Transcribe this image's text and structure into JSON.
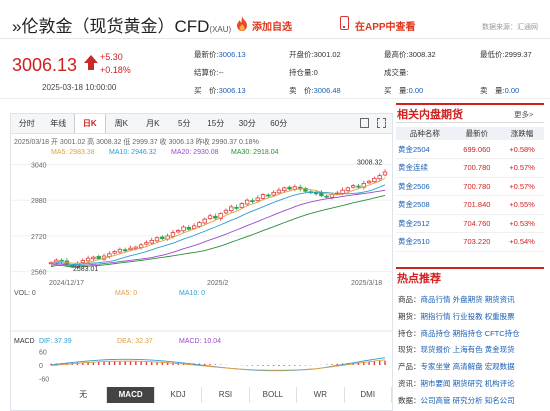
{
  "header": {
    "title": "»伦敦金（现货黄金）CFD",
    "code": "(XAU)",
    "add_favorite": "添加自选",
    "view_in_app": "在APP中查看",
    "source": "数据来源：汇通网"
  },
  "quote": {
    "price": "3006.13",
    "change": "+5.30",
    "change_pct": "+0.18%",
    "time": "2025-03-18 10:00:00"
  },
  "stats": [
    {
      "label": "最新价:",
      "value": "3006.13",
      "cls": "b"
    },
    {
      "label": "开盘价:",
      "value": "3001.02",
      "cls": "v"
    },
    {
      "label": "最高价:",
      "value": "3008.32",
      "cls": "v"
    },
    {
      "label": "最低价:",
      "value": "2999.37",
      "cls": "v"
    },
    {
      "label": "结算价:",
      "value": "--",
      "cls": "v"
    },
    {
      "label": "持仓量:",
      "value": "0",
      "cls": "v"
    },
    {
      "label": "成交量:",
      "value": "",
      "cls": "v"
    },
    {
      "label": "",
      "value": "",
      "cls": "v"
    },
    {
      "label": "买　价:",
      "value": "3006.13",
      "cls": "b"
    },
    {
      "label": "卖　价:",
      "value": "3006.48",
      "cls": "b"
    },
    {
      "label": "买　量:",
      "value": "0.00",
      "cls": "b"
    },
    {
      "label": "卖　量:",
      "value": "0.00",
      "cls": "b"
    }
  ],
  "chart": {
    "tabs": [
      "分时",
      "年线",
      "日K",
      "周K",
      "月K",
      "5分",
      "15分",
      "30分",
      "60分"
    ],
    "active_tab": "日K",
    "ohlc_line": {
      "date": "2025/03/18",
      "open": "开 3001.02",
      "high": "高 3008.32",
      "low": "低 2999.37",
      "close": "收 3006.13",
      "prev_close": "昨收 2990.37",
      "pct": "0.18%"
    },
    "ma": {
      "ma5": "MA5: 2983.38",
      "ma10": "MA10: 2946.32",
      "ma20": "MA20: 2930.08",
      "ma30": "MA30: 2918.04"
    },
    "y_ticks": [
      "3040",
      "2880",
      "2720",
      "2560"
    ],
    "max_label": "3008.32",
    "min_label": "2583.01",
    "x_labels": [
      "2024/12/17",
      "2025/2",
      "2025/3/18"
    ],
    "vol": {
      "label": "VOL: 0",
      "ma5": "MA5: 0",
      "ma10": "MA10: 0"
    },
    "macd": {
      "label": "MACD",
      "dif": "DIF: 37.39",
      "dea": "DEA: 32.37",
      "macd": "MACD: 10.04",
      "ticks": [
        "60",
        "0",
        "-60"
      ]
    },
    "bottom_tabs": [
      "无",
      "MACD",
      "KDJ",
      "RSI",
      "BOLL",
      "WR",
      "DMI"
    ],
    "active_bottom": "MACD"
  },
  "colors": {
    "up": "#e03c3c",
    "down": "#2aa44a",
    "ma5": "#e0a040",
    "ma10": "#2aa0d0",
    "ma20": "#9c4ad0",
    "ma30": "#2c8e3a"
  },
  "futures": {
    "title": "相关内盘期货",
    "more": "更多>",
    "headers": [
      "品种名称",
      "最新价",
      "涨跌幅"
    ],
    "rows": [
      {
        "name": "黄金2504",
        "price": "699.060",
        "pct": "+0.58%"
      },
      {
        "name": "黄金连续",
        "price": "700.780",
        "pct": "+0.57%"
      },
      {
        "name": "黄金2506",
        "price": "700.780",
        "pct": "+0.57%"
      },
      {
        "name": "黄金2508",
        "price": "701.840",
        "pct": "+0.55%"
      },
      {
        "name": "黄金2512",
        "price": "704.760",
        "pct": "+0.53%"
      },
      {
        "name": "黄金2510",
        "price": "703.220",
        "pct": "+0.54%"
      }
    ]
  },
  "hot": {
    "title": "热点推荐",
    "rows": [
      {
        "key": "商品：",
        "links": [
          "商品行情",
          "外盘期货",
          "期货资讯"
        ]
      },
      {
        "key": "期货：",
        "links": [
          "期指行情",
          "行业投教",
          "权重股票"
        ]
      },
      {
        "key": "持仓：",
        "links": [
          "商品持仓",
          "期指持仓",
          "CFTC持仓"
        ]
      },
      {
        "key": "现货：",
        "links": [
          "现货报价",
          "上海有色",
          "黄金现货"
        ]
      },
      {
        "key": "产品：",
        "links": [
          "专家坐堂",
          "高清解盘",
          "宏观数据"
        ]
      },
      {
        "key": "资讯：",
        "links": [
          "期市要闻",
          "期货研究",
          "机构评论"
        ]
      },
      {
        "key": "数据：",
        "links": [
          "公司高管",
          "研究分析",
          "知名公司"
        ]
      }
    ]
  }
}
